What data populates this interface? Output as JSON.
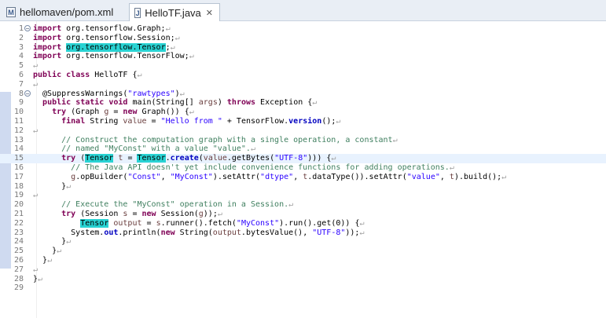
{
  "tabs": [
    {
      "label": "hellomaven/pom.xml",
      "icon": "xml-file-icon",
      "active": false
    },
    {
      "label": "HelloTF.java",
      "icon": "java-file-icon",
      "active": true,
      "close": "✕"
    }
  ],
  "fold_marker": "−",
  "lines": [
    {
      "n": "1",
      "fold": true,
      "t": [
        [
          "import",
          "kw"
        ],
        [
          " org.tensorflow.Graph;",
          ""
        ],
        [
          "↵",
          "pil"
        ]
      ]
    },
    {
      "n": "2",
      "t": [
        [
          "import",
          "kw"
        ],
        [
          " org.tensorflow.Session;",
          ""
        ],
        [
          "↵",
          "pil"
        ]
      ]
    },
    {
      "n": "3",
      "t": [
        [
          "import",
          "kw"
        ],
        [
          " ",
          ""
        ],
        [
          "org.tensorflow.Tensor",
          "hl"
        ],
        [
          ";",
          ""
        ],
        [
          "↵",
          "pil"
        ]
      ]
    },
    {
      "n": "4",
      "t": [
        [
          "import",
          "kw"
        ],
        [
          " org.tensorflow.TensorFlow;",
          ""
        ],
        [
          "↵",
          "pil"
        ]
      ]
    },
    {
      "n": "5",
      "t": [
        [
          "↵",
          "pil"
        ]
      ]
    },
    {
      "n": "6",
      "t": [
        [
          "public",
          "kw"
        ],
        [
          " ",
          ""
        ],
        [
          "class",
          "kw"
        ],
        [
          " HelloTF {",
          ""
        ],
        [
          "↵",
          "pil"
        ]
      ]
    },
    {
      "n": "7",
      "t": [
        [
          "↵",
          "pil"
        ]
      ]
    },
    {
      "n": "8",
      "fold": true,
      "t": [
        [
          "  @SuppressWarnings(",
          ""
        ],
        [
          "\"rawtypes\"",
          "str"
        ],
        [
          ")",
          ""
        ],
        [
          "↵",
          "pil"
        ]
      ]
    },
    {
      "n": "9",
      "t": [
        [
          "  ",
          ""
        ],
        [
          "public",
          "kw"
        ],
        [
          " ",
          ""
        ],
        [
          "static",
          "kw"
        ],
        [
          " ",
          ""
        ],
        [
          "void",
          "kw"
        ],
        [
          " main(String[] ",
          ""
        ],
        [
          "args",
          "var"
        ],
        [
          ") ",
          ""
        ],
        [
          "throws",
          "kw"
        ],
        [
          " Exception {",
          ""
        ],
        [
          "↵",
          "pil"
        ]
      ]
    },
    {
      "n": "10",
      "t": [
        [
          "    ",
          ""
        ],
        [
          "try",
          "kw"
        ],
        [
          " (Graph ",
          ""
        ],
        [
          "g",
          "var"
        ],
        [
          " = ",
          ""
        ],
        [
          "new",
          "kw"
        ],
        [
          " Graph()) {",
          ""
        ],
        [
          "↵",
          "pil"
        ]
      ]
    },
    {
      "n": "11",
      "t": [
        [
          "      ",
          ""
        ],
        [
          "final",
          "kw"
        ],
        [
          " String ",
          ""
        ],
        [
          "value",
          "var"
        ],
        [
          " = ",
          ""
        ],
        [
          "\"Hello from \"",
          "str"
        ],
        [
          " + TensorFlow.",
          ""
        ],
        [
          "version",
          "fld"
        ],
        [
          "();",
          ""
        ],
        [
          "↵",
          "pil"
        ]
      ]
    },
    {
      "n": "12",
      "t": [
        [
          "↵",
          "pil"
        ]
      ]
    },
    {
      "n": "13",
      "t": [
        [
          "      ",
          ""
        ],
        [
          "// Construct the computation graph with a single operation, a constant",
          "com"
        ],
        [
          "↵",
          "pil"
        ]
      ]
    },
    {
      "n": "14",
      "t": [
        [
          "      ",
          ""
        ],
        [
          "// named \"MyConst\" with a value \"value\".",
          "com"
        ],
        [
          "↵",
          "pil"
        ]
      ]
    },
    {
      "n": "15",
      "cur": true,
      "t": [
        [
          "      ",
          ""
        ],
        [
          "try",
          "kw"
        ],
        [
          " (",
          ""
        ],
        [
          "Tensor",
          "hl"
        ],
        [
          " ",
          ""
        ],
        [
          "t",
          "var"
        ],
        [
          " = ",
          ""
        ],
        [
          "Tensor",
          "hl"
        ],
        [
          ".",
          ""
        ],
        [
          "create",
          "fld"
        ],
        [
          "(",
          ""
        ],
        [
          "value",
          "var"
        ],
        [
          ".getBytes(",
          ""
        ],
        [
          "\"UTF-8\"",
          "str"
        ],
        [
          "))) {",
          ""
        ],
        [
          "↵",
          "pil"
        ]
      ]
    },
    {
      "n": "16",
      "t": [
        [
          "        ",
          ""
        ],
        [
          "// The Java API doesn't yet include convenience functions for adding operations.",
          "com"
        ],
        [
          "↵",
          "pil"
        ]
      ]
    },
    {
      "n": "17",
      "t": [
        [
          "        ",
          ""
        ],
        [
          "g",
          "var"
        ],
        [
          ".opBuilder(",
          ""
        ],
        [
          "\"Const\"",
          "str"
        ],
        [
          ", ",
          ""
        ],
        [
          "\"MyConst\"",
          "str"
        ],
        [
          ").setAttr(",
          ""
        ],
        [
          "\"dtype\"",
          "str"
        ],
        [
          ", ",
          ""
        ],
        [
          "t",
          "var"
        ],
        [
          ".dataType()).setAttr(",
          ""
        ],
        [
          "\"value\"",
          "str"
        ],
        [
          ", ",
          ""
        ],
        [
          "t",
          "var"
        ],
        [
          ").build();",
          ""
        ],
        [
          "↵",
          "pil"
        ]
      ]
    },
    {
      "n": "18",
      "t": [
        [
          "      }",
          ""
        ],
        [
          "↵",
          "pil"
        ]
      ]
    },
    {
      "n": "19",
      "t": [
        [
          "↵",
          "pil"
        ]
      ]
    },
    {
      "n": "20",
      "t": [
        [
          "      ",
          ""
        ],
        [
          "// Execute the \"MyConst\" operation in a Session.",
          "com"
        ],
        [
          "↵",
          "pil"
        ]
      ]
    },
    {
      "n": "21",
      "t": [
        [
          "      ",
          ""
        ],
        [
          "try",
          "kw"
        ],
        [
          " (Session ",
          ""
        ],
        [
          "s",
          "var"
        ],
        [
          " = ",
          ""
        ],
        [
          "new",
          "kw"
        ],
        [
          " Session(",
          ""
        ],
        [
          "g",
          "var"
        ],
        [
          "));",
          ""
        ],
        [
          "↵",
          "pil"
        ]
      ]
    },
    {
      "n": "22",
      "t": [
        [
          "          ",
          ""
        ],
        [
          "Tensor",
          "hl"
        ],
        [
          " ",
          ""
        ],
        [
          "output",
          "var"
        ],
        [
          " = ",
          ""
        ],
        [
          "s",
          "var"
        ],
        [
          ".runner().fetch(",
          ""
        ],
        [
          "\"MyConst\"",
          "str"
        ],
        [
          ").run().get(0)) {",
          ""
        ],
        [
          "↵",
          "pil"
        ]
      ]
    },
    {
      "n": "23",
      "t": [
        [
          "        System.",
          ""
        ],
        [
          "out",
          "fld"
        ],
        [
          ".println(",
          ""
        ],
        [
          "new",
          "kw"
        ],
        [
          " String(",
          ""
        ],
        [
          "output",
          "var"
        ],
        [
          ".bytesValue(), ",
          ""
        ],
        [
          "\"UTF-8\"",
          "str"
        ],
        [
          "));",
          ""
        ],
        [
          "↵",
          "pil"
        ]
      ]
    },
    {
      "n": "24",
      "t": [
        [
          "      }",
          ""
        ],
        [
          "↵",
          "pil"
        ]
      ]
    },
    {
      "n": "25",
      "t": [
        [
          "    }",
          ""
        ],
        [
          "↵",
          "pil"
        ]
      ]
    },
    {
      "n": "26",
      "t": [
        [
          "  }",
          ""
        ],
        [
          "↵",
          "pil"
        ]
      ]
    },
    {
      "n": "27",
      "t": [
        [
          "↵",
          "pil"
        ]
      ]
    },
    {
      "n": "28",
      "t": [
        [
          "}",
          ""
        ],
        [
          "↵",
          "pil"
        ]
      ]
    },
    {
      "n": "29",
      "t": []
    }
  ]
}
